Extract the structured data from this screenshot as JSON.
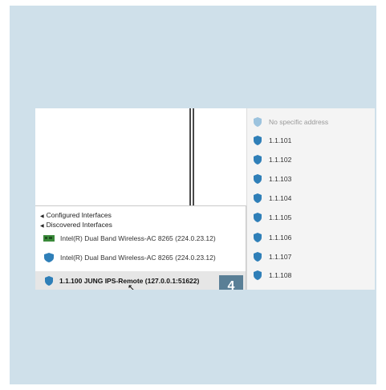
{
  "colors": {
    "panel": "#cfe0ea",
    "accent": "#2f7fb8",
    "badge": "#5a7f96",
    "selected": "#e6e6e6"
  },
  "left": {
    "group_configured": "Configured Interfaces",
    "group_discovered": "Discovered Interfaces",
    "interfaces": [
      {
        "label": "Intel(R) Dual Band Wireless-AC 8265 (224.0.23.12)",
        "icon": "network-card-icon"
      },
      {
        "label": "Intel(R) Dual Band Wireless-AC 8265 (224.0.23.12)",
        "icon": "shield-icon"
      }
    ],
    "selected": {
      "label": "1.1.100 JUNG IPS-Remote (127.0.0.1:51622)",
      "icon": "shield-icon"
    }
  },
  "badge": "4",
  "addresses": [
    {
      "label": "No specific address",
      "dim": true
    },
    {
      "label": "1.1.101"
    },
    {
      "label": "1.1.102"
    },
    {
      "label": "1.1.103"
    },
    {
      "label": "1.1.104"
    },
    {
      "label": "1.1.105"
    },
    {
      "label": "1.1.106"
    },
    {
      "label": "1.1.107"
    },
    {
      "label": "1.1.108"
    }
  ]
}
